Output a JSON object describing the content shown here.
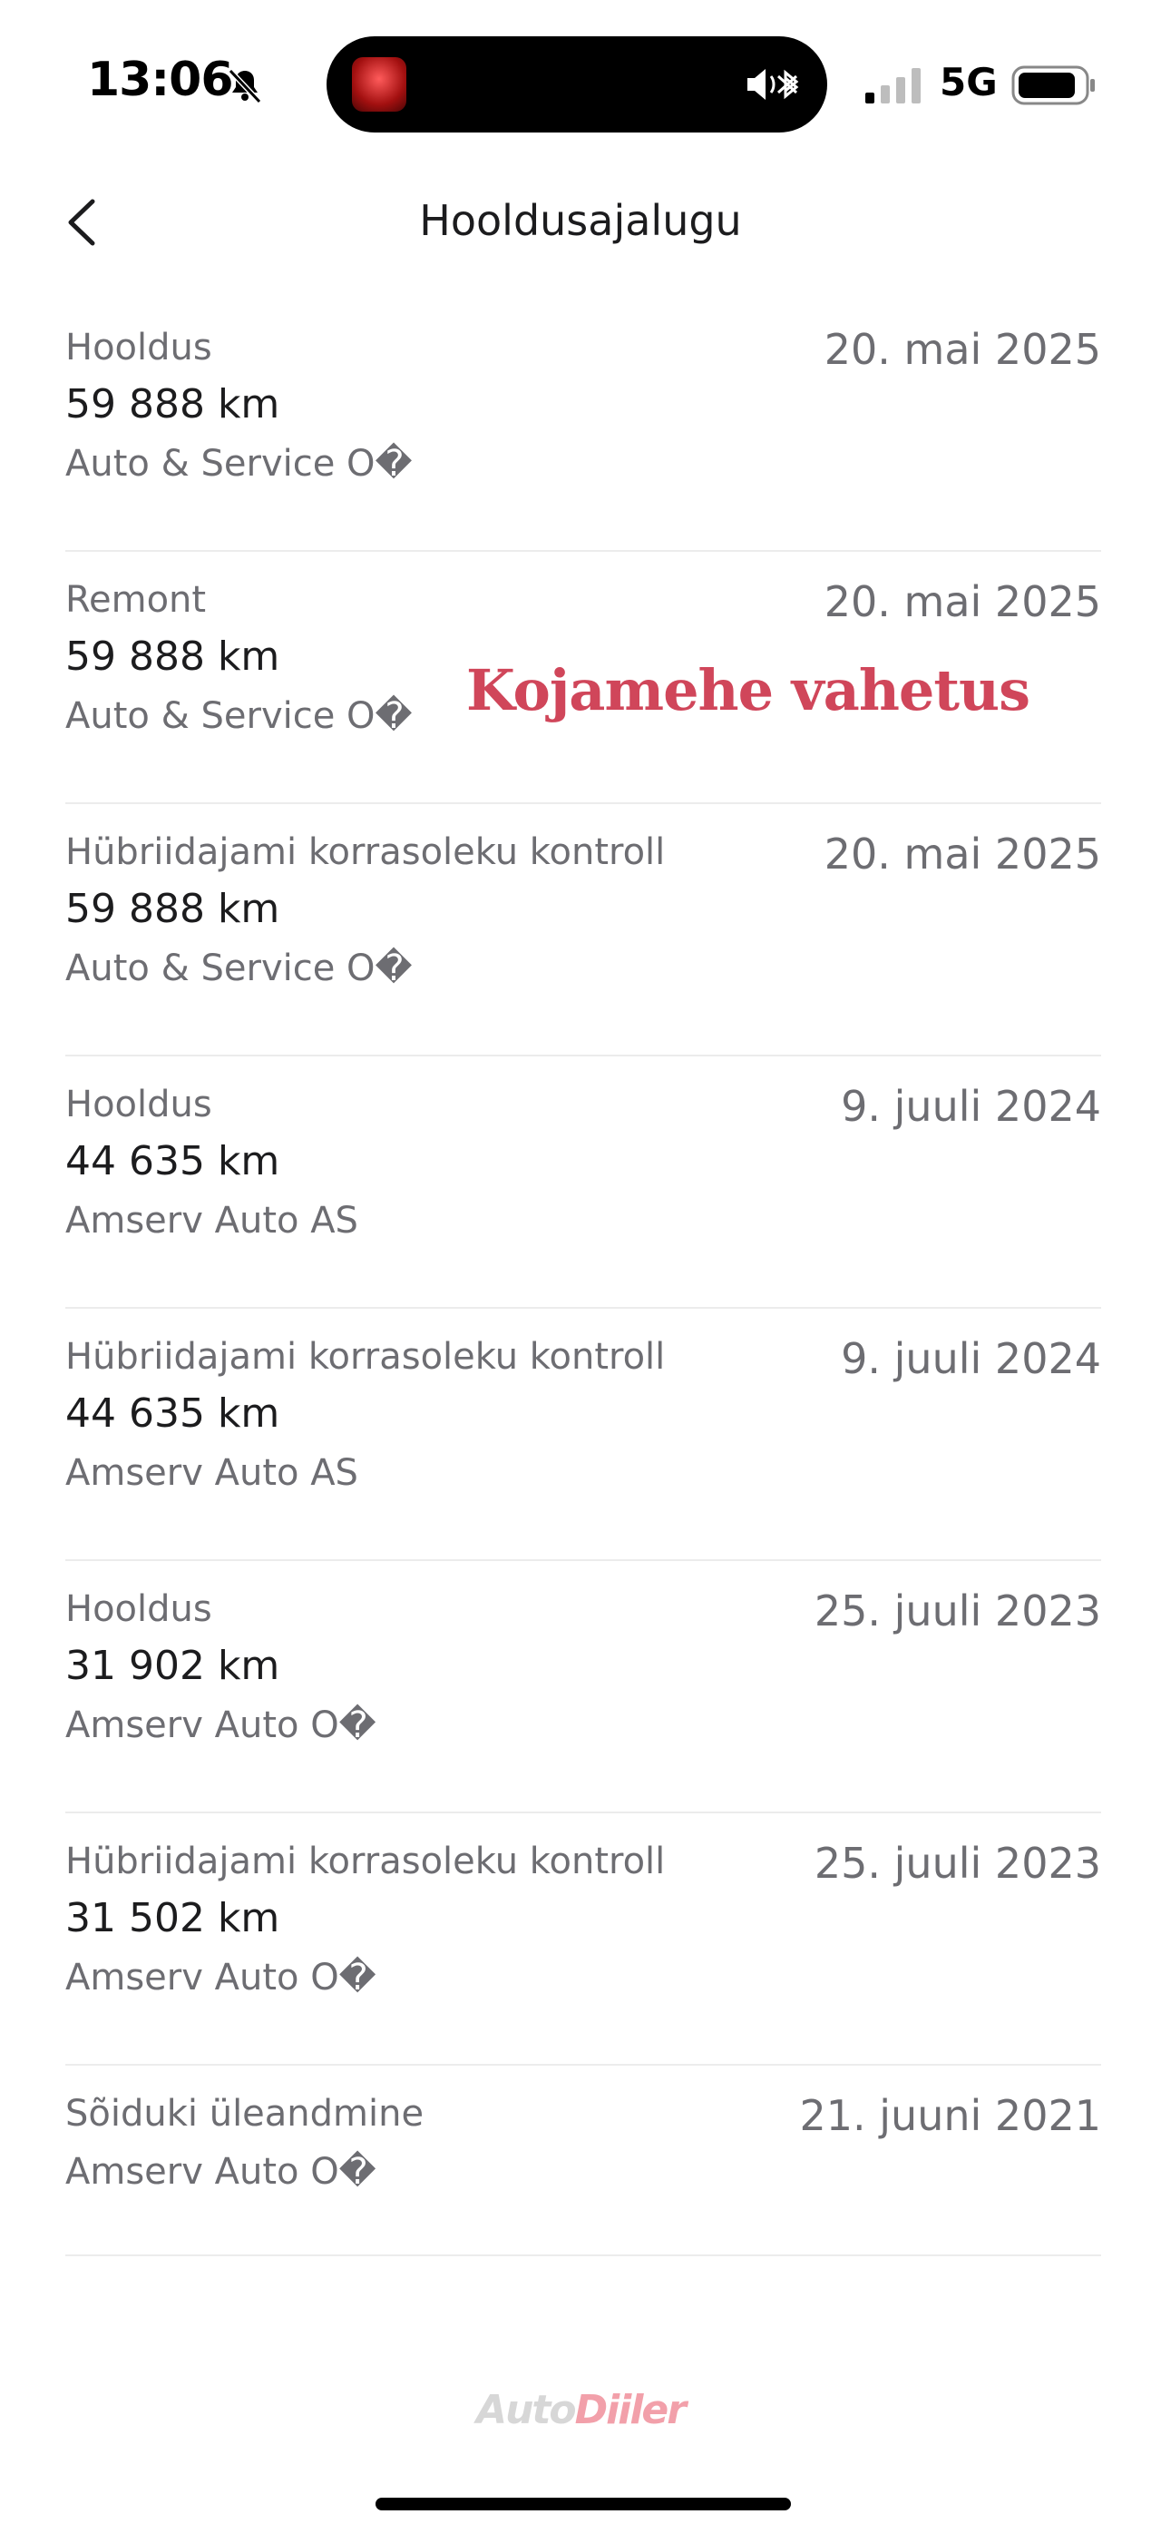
{
  "status_bar": {
    "time": "13:06",
    "network": "5G",
    "icons": [
      "bell-slash-icon",
      "speaker-icon",
      "bluetooth-icon",
      "signal-icon",
      "battery-icon"
    ]
  },
  "header": {
    "title": "Hooldusajalugu",
    "back_icon": "chevron-left-icon"
  },
  "history": [
    {
      "type": "Hooldus",
      "date": "20. mai 2025",
      "mileage": "59 888 km",
      "dealer": "Auto & Service O�"
    },
    {
      "type": "Remont",
      "date": "20. mai 2025",
      "mileage": "59 888 km",
      "dealer": "Auto & Service O�"
    },
    {
      "type": "Hübriidajami korrasoleku kontroll",
      "date": "20. mai 2025",
      "mileage": "59 888 km",
      "dealer": "Auto & Service O�"
    },
    {
      "type": "Hooldus",
      "date": "9. juuli 2024",
      "mileage": "44 635 km",
      "dealer": "Amserv Auto AS"
    },
    {
      "type": "Hübriidajami korrasoleku kontroll",
      "date": "9. juuli 2024",
      "mileage": "44 635 km",
      "dealer": "Amserv Auto AS"
    },
    {
      "type": "Hooldus",
      "date": "25. juuli 2023",
      "mileage": "31 902 km",
      "dealer": "Amserv Auto O�"
    },
    {
      "type": "Hübriidajami korrasoleku kontroll",
      "date": "25. juuli 2023",
      "mileage": "31 502 km",
      "dealer": "Amserv Auto O�"
    },
    {
      "type": "Sõiduki üleandmine",
      "date": "21. juuni 2021",
      "dealer": "Amserv Auto O�"
    }
  ],
  "overlay_note": "Kojamehe vahetus",
  "watermark": {
    "part1": "Auto",
    "part2": "Diiler"
  },
  "colors": {
    "accent_note": "#d0465a",
    "secondary_text": "#6d6d72",
    "divider": "#ececec"
  }
}
